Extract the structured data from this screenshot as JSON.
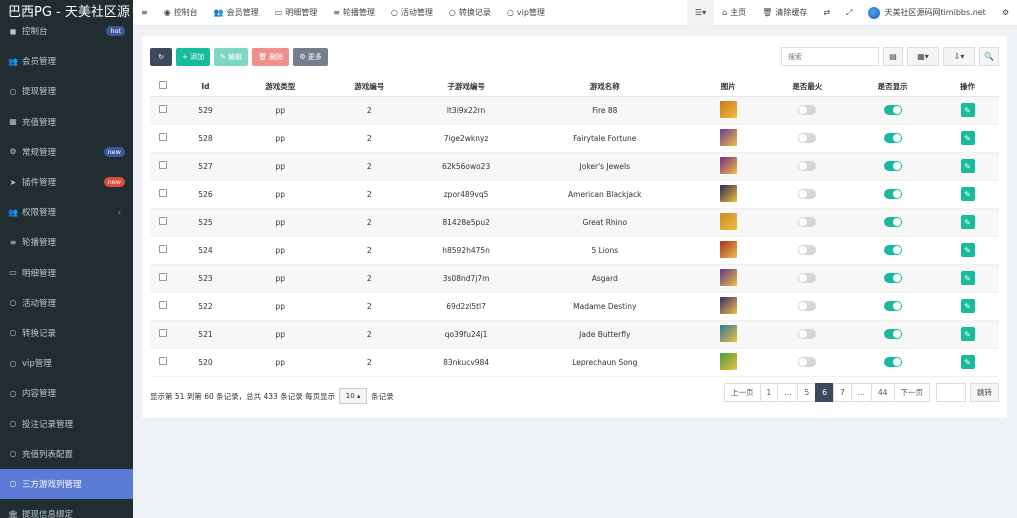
{
  "app": {
    "title": "巴西PG - 天美社区源"
  },
  "sidebar": {
    "items": [
      {
        "label": "控制台",
        "icon": "dashboard-icon",
        "glyph": "◼",
        "badge": "hot"
      },
      {
        "label": "会员管理",
        "icon": "users-icon",
        "glyph": "👥"
      },
      {
        "label": "提现管理",
        "icon": "circle-icon",
        "glyph": "○"
      },
      {
        "label": "充值管理",
        "icon": "grid-icon",
        "glyph": "▦"
      },
      {
        "label": "常规管理",
        "icon": "cogs-icon",
        "glyph": "⚙",
        "badge": "new"
      },
      {
        "label": "插件管理",
        "icon": "rocket-icon",
        "glyph": "➤",
        "badge": "new"
      },
      {
        "label": "权限管理",
        "icon": "group-icon",
        "glyph": "👥",
        "chevron": "‹"
      },
      {
        "label": "轮播管理",
        "icon": "list-icon",
        "glyph": "≡"
      },
      {
        "label": "明细管理",
        "icon": "calendar-icon",
        "glyph": "▭"
      },
      {
        "label": "活动管理",
        "icon": "circle-icon",
        "glyph": "○"
      },
      {
        "label": "转换记录",
        "icon": "circle-icon",
        "glyph": "○"
      },
      {
        "label": "vip管理",
        "icon": "circle-icon",
        "glyph": "○"
      },
      {
        "label": "内容管理",
        "icon": "circle-icon",
        "glyph": "○"
      },
      {
        "label": "投注记录管理",
        "icon": "circle-icon",
        "glyph": "○"
      },
      {
        "label": "充值列表配置",
        "icon": "circle-icon",
        "glyph": "○"
      },
      {
        "label": "三方游戏列管理",
        "icon": "circle-icon",
        "glyph": "○",
        "active": true
      },
      {
        "label": "提现信息绑定",
        "icon": "bank-icon",
        "glyph": "🏛"
      }
    ]
  },
  "topbar": {
    "menu_glyph": "≡",
    "items": [
      {
        "label": "控制台",
        "glyph": "◉"
      },
      {
        "label": "会员管理",
        "glyph": "👥"
      },
      {
        "label": "明细管理",
        "glyph": "▭"
      },
      {
        "label": "轮播管理",
        "glyph": "≡"
      },
      {
        "label": "活动管理",
        "glyph": "○"
      },
      {
        "label": "转换记录",
        "glyph": "○"
      },
      {
        "label": "vip管理",
        "glyph": "○"
      }
    ],
    "right": {
      "list_glyph": "☰▾",
      "home_label": "主页",
      "home_glyph": "⌂",
      "clear_label": "清除缓存",
      "clear_glyph": "🗑",
      "translate_glyph": "⇄",
      "fullscreen_glyph": "⤢",
      "site_label": "天美社区源码网timibbs.net",
      "settings_glyph": "⚙"
    }
  },
  "toolbar": {
    "refresh_glyph": "↻",
    "add_label": "+ 添加",
    "edit_label": "✎ 编辑",
    "delete_label": "🗑 删除",
    "more_label": "⚙ 更多"
  },
  "search": {
    "placeholder": "搜索",
    "toggle_glyph": "▤",
    "columns_glyph": "▦▾",
    "export_glyph": "⇩▾",
    "search_glyph": "🔍"
  },
  "table": {
    "headers": [
      "",
      "Id",
      "游戏类型",
      "游戏编号",
      "子游戏编号",
      "游戏名称",
      "图片",
      "是否最火",
      "是否显示",
      "操作"
    ],
    "rows": [
      {
        "id": "529",
        "type": "pp",
        "num": "2",
        "sub": "lt3i9x22rn",
        "name": "Fire 88",
        "hot": false,
        "show": true,
        "color": "#c8751a"
      },
      {
        "id": "528",
        "type": "pp",
        "num": "2",
        "sub": "7ige2wknyz",
        "name": "Fairytale Fortune",
        "hot": false,
        "show": true,
        "color": "#6a3a9a"
      },
      {
        "id": "527",
        "type": "pp",
        "num": "2",
        "sub": "62k56owo23",
        "name": "Joker's Jewels",
        "hot": false,
        "show": true,
        "color": "#7a2a8a"
      },
      {
        "id": "526",
        "type": "pp",
        "num": "2",
        "sub": "zpor489vq5",
        "name": "American Blackjack",
        "hot": false,
        "show": true,
        "color": "#2a2a4a"
      },
      {
        "id": "525",
        "type": "pp",
        "num": "2",
        "sub": "81428e5pu2",
        "name": "Great Rhino",
        "hot": false,
        "show": true,
        "color": "#c88a2a"
      },
      {
        "id": "524",
        "type": "pp",
        "num": "2",
        "sub": "h8592h475n",
        "name": "5 Lions",
        "hot": false,
        "show": true,
        "color": "#a8302a"
      },
      {
        "id": "523",
        "type": "pp",
        "num": "2",
        "sub": "3s08nd7j7m",
        "name": "Asgard",
        "hot": false,
        "show": true,
        "color": "#5a3a8a"
      },
      {
        "id": "522",
        "type": "pp",
        "num": "2",
        "sub": "69d2zl5tl7",
        "name": "Madame Destiny",
        "hot": false,
        "show": true,
        "color": "#3a2a6a"
      },
      {
        "id": "521",
        "type": "pp",
        "num": "2",
        "sub": "qo39fu24j1",
        "name": "Jade Butterfly",
        "hot": false,
        "show": true,
        "color": "#2a7a9a"
      },
      {
        "id": "520",
        "type": "pp",
        "num": "2",
        "sub": "83nkucv984",
        "name": "Leprechaun Song",
        "hot": false,
        "show": true,
        "color": "#4a9a3a"
      }
    ]
  },
  "footer": {
    "info_prefix": "显示第 51 到第 60 条记录，总共 433 条记录 每页显示",
    "page_size": "10 ▴",
    "info_suffix": "条记录"
  },
  "pagination": {
    "items": [
      {
        "label": "上一页"
      },
      {
        "label": "1"
      },
      {
        "label": "..."
      },
      {
        "label": "5"
      },
      {
        "label": "6",
        "active": true
      },
      {
        "label": "7"
      },
      {
        "label": "..."
      },
      {
        "label": "44"
      },
      {
        "label": "下一页"
      }
    ],
    "go_label": "跳转"
  }
}
